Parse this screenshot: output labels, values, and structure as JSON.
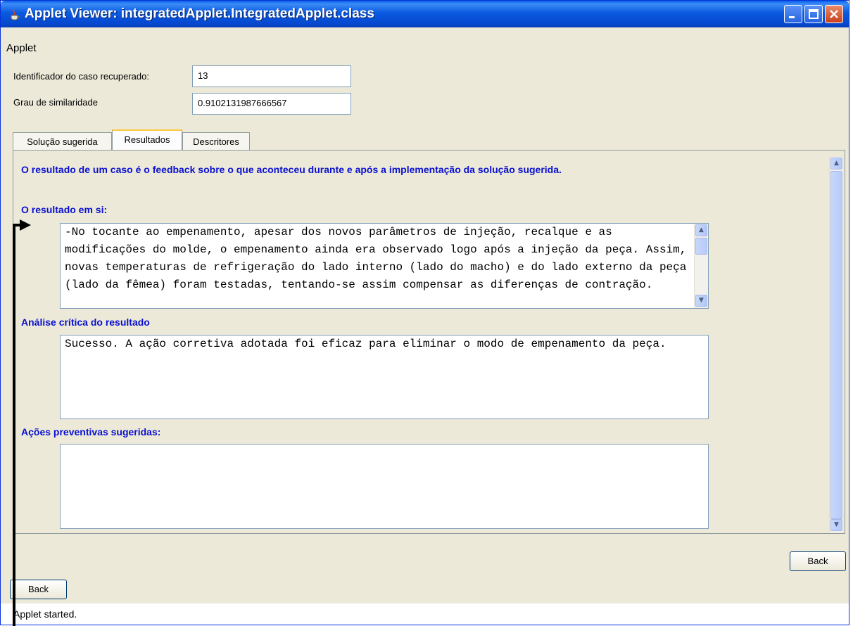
{
  "window": {
    "title": "Applet Viewer: integratedApplet.IntegratedApplet.class",
    "controls": [
      "minimize-icon",
      "maximize-icon",
      "close-icon"
    ]
  },
  "menu": {
    "applet": "Applet"
  },
  "form": {
    "case_id_label": "Identificador do caso recuperado:",
    "case_id_value": "13",
    "similarity_label": "Grau de similaridade",
    "similarity_value": "0.9102131987666567"
  },
  "tabs": [
    {
      "label": "Solução sugerida"
    },
    {
      "label": "Resultados"
    },
    {
      "label": "Descritores"
    }
  ],
  "content": {
    "intro": "O resultado de um caso é o feedback sobre o que aconteceu durante e após a implementação da solução sugerida.",
    "result_label": "O resultado em si:",
    "result_text": "-No tocante ao empenamento, apesar dos novos parâmetros de injeção, recalque e as modificações do molde, o empenamento ainda era observado logo após a injeção da peça. Assim, novas temperaturas de refrigeração do lado interno (lado do macho) e do lado externo da peça (lado da fêmea) foram testadas, tentando-se assim compensar as diferenças de contração.",
    "analysis_label": "Análise crítica do resultado",
    "analysis_text": "Sucesso. A ação corretiva adotada foi eficaz para eliminar o modo de empenamento da peça.",
    "preventive_label": "Ações preventivas sugeridas:",
    "preventive_text": ""
  },
  "buttons": {
    "back_right": "Back",
    "back_left": "Back"
  },
  "status": "Applet started."
}
